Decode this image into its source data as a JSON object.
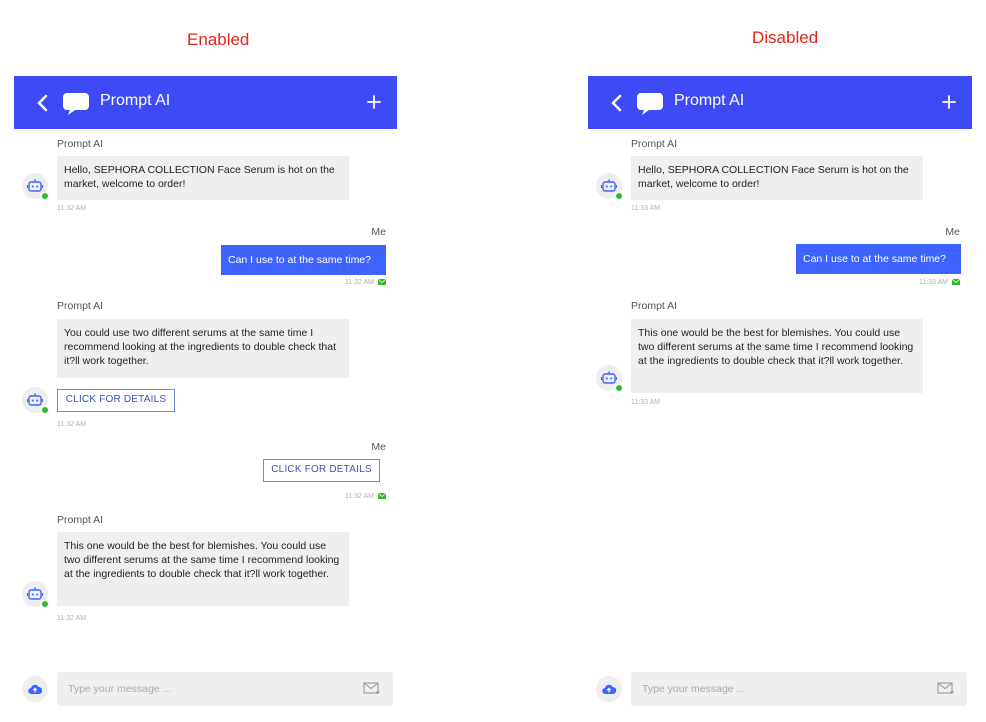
{
  "colors": {
    "header": "#3d4bf6",
    "me_bubble": "#3f63ff",
    "label": "#e0261b",
    "online": "#2fb82f",
    "button_border": "#6d8ed6"
  },
  "enabled": {
    "section_label": "Enabled",
    "header": {
      "title": "Prompt AI",
      "back_icon": "chevron-left-icon",
      "logo_icon": "chat-bubble-icon",
      "add_icon": "plus-icon"
    },
    "msg1": {
      "sender": "Prompt AI",
      "text": "Hello, SEPHORA COLLECTION Face Serum is hot on the market, welcome to order!",
      "time": "11:32 AM"
    },
    "msg2": {
      "sender": "Me",
      "text": "Can I use to at the same time?",
      "time": "11:32 AM"
    },
    "msg3": {
      "sender": "Prompt AI",
      "text": "You could use two different serums at the same time I recommend looking at the ingredients to double check that it?ll work together.",
      "button": "CLICK FOR DETAILS",
      "time": "11:32 AM"
    },
    "msg4": {
      "sender": "Me",
      "button": "CLICK FOR DETAILS",
      "time": "11:32 AM"
    },
    "msg5": {
      "sender": "Prompt AI",
      "text": "This one would be the best for blemishes. You could use two different serums at the same time I recommend looking at the ingredients to double check that it?ll work together.",
      "time": "11:32 AM"
    },
    "composer": {
      "placeholder": "Type your message ..."
    }
  },
  "disabled": {
    "section_label": "Disabled",
    "header": {
      "title": "Prompt AI",
      "back_icon": "chevron-left-icon",
      "logo_icon": "chat-bubble-icon",
      "add_icon": "plus-icon"
    },
    "msg1": {
      "sender": "Prompt AI",
      "text": "Hello, SEPHORA COLLECTION Face Serum is hot on the market, welcome to order!",
      "time": "11:33 AM"
    },
    "msg2": {
      "sender": "Me",
      "text": "Can I use to at the same time?",
      "time": "11:33 AM"
    },
    "msg3": {
      "sender": "Prompt AI",
      "text": "This one would be the best for blemishes. You could use two different serums at the same time I recommend looking at the ingredients to double check that it?ll work together.",
      "time": "11:33 AM"
    },
    "composer": {
      "placeholder": "Type your message ..."
    }
  }
}
